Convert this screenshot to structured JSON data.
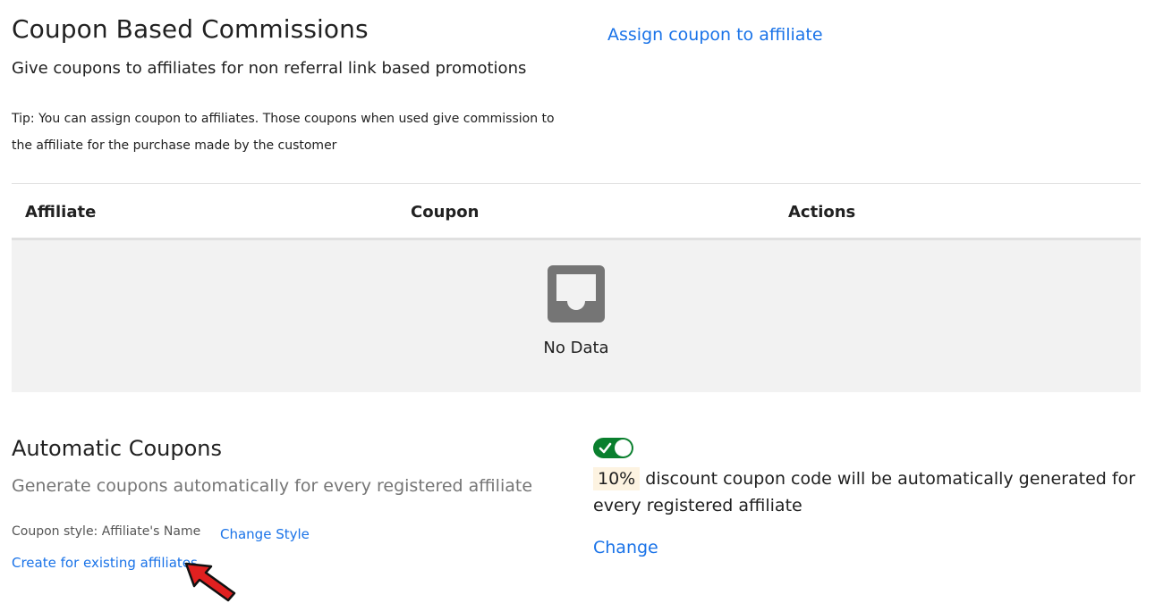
{
  "header": {
    "title": "Coupon Based Commissions",
    "subtitle": "Give coupons to affiliates for non referral link based promotions",
    "tip": "Tip: You can assign coupon to affiliates. Those coupons when used give commission to the affiliate for the purchase made by the customer",
    "assign_link": "Assign coupon to affiliate"
  },
  "table": {
    "columns": [
      "Affiliate",
      "Coupon",
      "Actions"
    ],
    "rows": [],
    "empty_text": "No Data",
    "empty_icon": "inbox-icon"
  },
  "automatic": {
    "title": "Automatic Coupons",
    "subtitle": "Generate coupons automatically for every registered affiliate",
    "coupon_style_label": "Coupon style: Affiliate's Name",
    "change_style_link": "Change Style",
    "create_existing_link": "Create for existing affiliates",
    "toggle_enabled": true,
    "discount_percent": "10%",
    "discount_text": "discount coupon code will be automatically generated for every registered affiliate",
    "change_link": "Change"
  },
  "colors": {
    "link": "#1a73e8",
    "toggle_on": "#0a7f2e",
    "table_empty_bg": "#f2f2f2",
    "badge_bg": "#fdf3e1",
    "arrow": "#e02020"
  }
}
